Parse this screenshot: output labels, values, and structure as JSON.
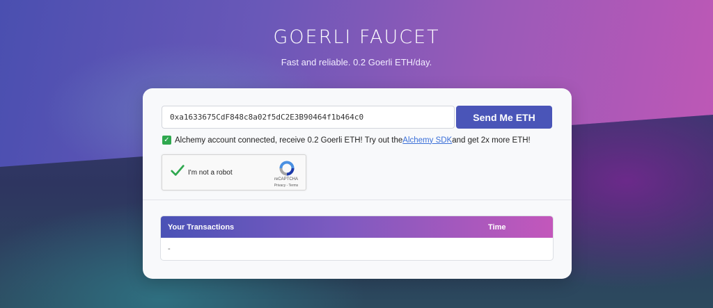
{
  "header": {
    "title": "GOERLI FAUCET",
    "subtitle": "Fast and reliable. 0.2 Goerli ETH/day."
  },
  "form": {
    "address_value": "0xa1633675CdF848c8a02f5dC2E3B90464f1b464c0",
    "send_button_label": "Send Me ETH"
  },
  "notice": {
    "text_before": "Alchemy account connected, receive 0.2 Goerli ETH! Try out the ",
    "link_text": "Alchemy SDK",
    "text_after": " and get 2x more ETH!",
    "checked": true
  },
  "captcha": {
    "label": "I'm not a robot",
    "brand": "reCAPTCHA",
    "links": "Privacy - Terms",
    "verified": true
  },
  "transactions": {
    "columns": [
      "Your Transactions",
      "Time"
    ],
    "rows": [
      [
        "-"
      ]
    ]
  },
  "colors": {
    "button": "#4a55b8",
    "check_green": "#2fa84f",
    "link": "#3a6fd8"
  }
}
